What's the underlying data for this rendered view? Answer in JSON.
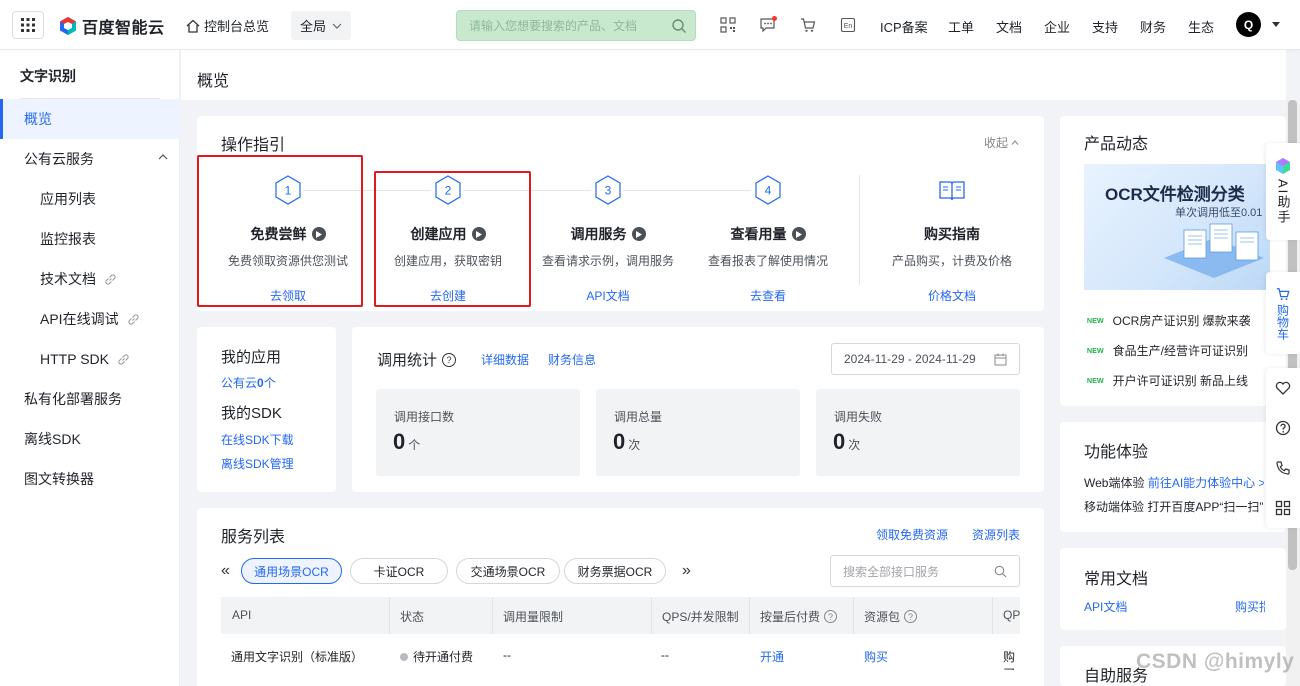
{
  "topbar": {
    "logo_text": "百度智能云",
    "home_label": "控制台总览",
    "region_label": "全局",
    "search_placeholder": "请输入您想要搜索的产品、文档",
    "nav": [
      "ICP备案",
      "工单",
      "文档",
      "企业",
      "支持",
      "财务",
      "生态"
    ],
    "avatar_initial": "Q",
    "icons": [
      "qrcode-icon",
      "message-icon",
      "cart-icon",
      "language-icon"
    ]
  },
  "sidebar": {
    "title": "文字识别",
    "items": [
      {
        "label": "概览",
        "level": 1,
        "active": true
      },
      {
        "label": "公有云服务",
        "level": 1,
        "expanded": true
      },
      {
        "label": "应用列表",
        "level": 2
      },
      {
        "label": "监控报表",
        "level": 2
      },
      {
        "label": "技术文档",
        "level": 2,
        "external": true
      },
      {
        "label": "API在线调试",
        "level": 2,
        "external": true
      },
      {
        "label": "HTTP SDK",
        "level": 2,
        "external": true
      },
      {
        "label": "私有化部署服务",
        "level": 1
      },
      {
        "label": "离线SDK",
        "level": 1
      },
      {
        "label": "图文转换器",
        "level": 1
      }
    ]
  },
  "page": {
    "title": "概览"
  },
  "guide": {
    "title": "操作指引",
    "collapse_label": "收起",
    "steps": [
      {
        "num": "1",
        "name": "免费尝鲜",
        "desc": "免费领取资源供您测试",
        "link": "去领取"
      },
      {
        "num": "2",
        "name": "创建应用",
        "desc": "创建应用，获取密钥",
        "link": "去创建"
      },
      {
        "num": "3",
        "name": "调用服务",
        "desc": "查看请求示例，调用服务",
        "link": "API文档"
      },
      {
        "num": "4",
        "name": "查看用量",
        "desc": "查看报表了解使用情况",
        "link": "去查看"
      }
    ],
    "purchase": {
      "name": "购买指南",
      "desc": "产品购买，计费及价格",
      "link": "价格文档"
    }
  },
  "my_app": {
    "title": "我的应用",
    "public_cloud_prefix": "公有云",
    "public_cloud_count": "0",
    "public_cloud_suffix": "个",
    "sdk_title": "我的SDK",
    "sdk_links": [
      "在线SDK下载",
      "离线SDK管理"
    ]
  },
  "call_stats": {
    "title": "调用统计",
    "links": [
      "详细数据",
      "财务信息"
    ],
    "date_range": "2024-11-29 - 2024-11-29",
    "boxes": [
      {
        "label": "调用接口数",
        "value": "0",
        "unit": "个"
      },
      {
        "label": "调用总量",
        "value": "0",
        "unit": "次"
      },
      {
        "label": "调用失败",
        "value": "0",
        "unit": "次"
      }
    ]
  },
  "service_list": {
    "title": "服务列表",
    "links": [
      "领取免费资源",
      "资源列表"
    ],
    "tabs": [
      "通用场景OCR",
      "卡证OCR",
      "交通场景OCR",
      "财务票据OCR"
    ],
    "active_tab": 0,
    "search_placeholder": "搜索全部接口服务",
    "columns": [
      "API",
      "状态",
      "调用量限制",
      "QPS/并发限制",
      "按量后付费",
      "资源包",
      "QP"
    ],
    "rows": [
      {
        "api": "通用文字识别（标准版）",
        "status": "待开通付费",
        "limit": "--",
        "qps": "--",
        "postpay": "开通",
        "package": "购买",
        "extra": "购买"
      }
    ]
  },
  "product_news": {
    "title": "产品动态",
    "banner_title": "OCR文件检测分类",
    "banner_sub": "单次调用低至0.01",
    "items": [
      {
        "tag": "NEW",
        "text": "OCR房产证识别 爆款来袭"
      },
      {
        "tag": "NEW",
        "text": "食品生产/经营许可证识别"
      },
      {
        "tag": "NEW",
        "text": "开户许可证识别 新品上线"
      }
    ]
  },
  "feature_trial": {
    "title": "功能体验",
    "web_prefix": "Web端体验",
    "web_link": "前往AI能力体验中心 >",
    "mobile_text": "移动端体验 打开百度APP“扫一扫”"
  },
  "common_docs": {
    "title": "常用文档",
    "links": [
      "API文档",
      "购买指"
    ]
  },
  "self_service": {
    "title": "自助服务"
  },
  "float_bar": {
    "ai_label": "AI助手",
    "cart_label": "购物车"
  },
  "watermark": "CSDN @himyly",
  "colors": {
    "accent": "#2468f2",
    "highlight_box": "#e0191d",
    "search_bg": "#c9e9cf",
    "new_tag": "#22b14c"
  }
}
